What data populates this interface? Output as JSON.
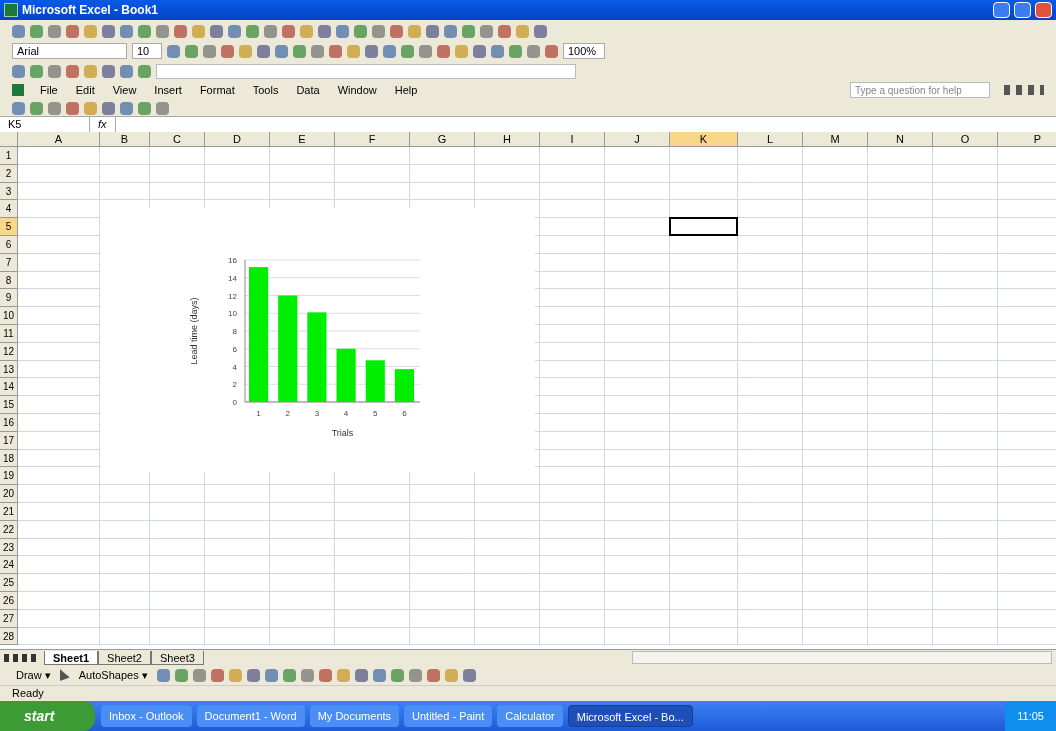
{
  "window": {
    "title": "Microsoft Excel - Book1"
  },
  "formatting": {
    "font": "Arial",
    "size": "10",
    "zoom": "100%"
  },
  "menu": [
    "File",
    "Edit",
    "View",
    "Insert",
    "Format",
    "Tools",
    "Data",
    "Window",
    "Help"
  ],
  "help_box": {
    "placeholder": "Type a question for help"
  },
  "formula_bar": {
    "name_box": "K5",
    "fx": "fx"
  },
  "columns": [
    {
      "label": "A",
      "selected": false
    },
    {
      "label": "B",
      "selected": false
    },
    {
      "label": "C",
      "selected": false
    },
    {
      "label": "D",
      "selected": false
    },
    {
      "label": "E",
      "selected": false
    },
    {
      "label": "F",
      "selected": false
    },
    {
      "label": "G",
      "selected": false
    },
    {
      "label": "H",
      "selected": false
    },
    {
      "label": "I",
      "selected": false
    },
    {
      "label": "J",
      "selected": false
    },
    {
      "label": "K",
      "selected": true
    },
    {
      "label": "L",
      "selected": false
    },
    {
      "label": "M",
      "selected": false
    },
    {
      "label": "N",
      "selected": false
    },
    {
      "label": "O",
      "selected": false
    },
    {
      "label": "P",
      "selected": false
    }
  ],
  "rows": [
    {
      "label": "1",
      "selected": false
    },
    {
      "label": "2",
      "selected": false
    },
    {
      "label": "3",
      "selected": false
    },
    {
      "label": "4",
      "selected": false
    },
    {
      "label": "5",
      "selected": true
    },
    {
      "label": "6",
      "selected": false
    },
    {
      "label": "7",
      "selected": false
    },
    {
      "label": "8",
      "selected": false
    },
    {
      "label": "9",
      "selected": false
    },
    {
      "label": "10",
      "selected": false
    },
    {
      "label": "11",
      "selected": false
    },
    {
      "label": "12",
      "selected": false
    },
    {
      "label": "13",
      "selected": false
    },
    {
      "label": "14",
      "selected": false
    },
    {
      "label": "15",
      "selected": false
    },
    {
      "label": "16",
      "selected": false
    },
    {
      "label": "17",
      "selected": false
    },
    {
      "label": "18",
      "selected": false
    },
    {
      "label": "19",
      "selected": false
    },
    {
      "label": "20",
      "selected": false
    },
    {
      "label": "21",
      "selected": false
    },
    {
      "label": "22",
      "selected": false
    },
    {
      "label": "23",
      "selected": false
    },
    {
      "label": "24",
      "selected": false
    },
    {
      "label": "25",
      "selected": false
    },
    {
      "label": "26",
      "selected": false
    },
    {
      "label": "27",
      "selected": false
    },
    {
      "label": "28",
      "selected": false
    }
  ],
  "chart": {
    "chart_data": {
      "type": "bar",
      "ylabel": "Lead time (days)",
      "xlabel": "Trials",
      "categories": [
        "1",
        "2",
        "3",
        "4",
        "5",
        "6"
      ],
      "series": [
        {
          "color": "#00ee00",
          "values": [
            15.2,
            12,
            10.1,
            6,
            4.7,
            3.7
          ]
        }
      ],
      "ylim": [
        0,
        16
      ],
      "yticks": [
        0,
        2,
        4,
        6,
        8,
        10,
        12,
        14,
        16
      ],
      "grid": true
    }
  },
  "sheets": [
    {
      "label": "Sheet1",
      "selected": true
    },
    {
      "label": "Sheet2",
      "selected": false
    },
    {
      "label": "Sheet3",
      "selected": false
    }
  ],
  "drawing": {
    "draw": "Draw ▾",
    "autoshapes": "AutoShapes ▾"
  },
  "status_bar": "Ready",
  "taskbar": {
    "start": "start",
    "tasks": [
      {
        "label": "Inbox - Outlook",
        "selected": false
      },
      {
        "label": "Document1 - Word",
        "selected": false
      },
      {
        "label": "My Documents",
        "selected": false
      },
      {
        "label": "Untitled - Paint",
        "selected": false
      },
      {
        "label": "Calculator",
        "selected": false
      },
      {
        "label": "Microsoft Excel - Bo...",
        "selected": true
      }
    ],
    "clock": "11:05"
  }
}
